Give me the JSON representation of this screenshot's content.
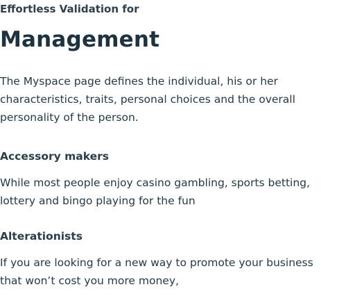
{
  "hero": {
    "eyebrow": "Effortless Validation for",
    "title": "Management",
    "intro": "The Myspace page defines the individual, his or her characteristics, traits, personal choices and the overall personality of the person."
  },
  "sections": [
    {
      "heading": "Accessory makers",
      "text": "While most people enjoy casino gambling, sports betting, lottery and bingo playing for the fun"
    },
    {
      "heading": "Alterationists",
      "text": "If you are looking for a new way to promote your business that won’t cost you more money,"
    }
  ]
}
